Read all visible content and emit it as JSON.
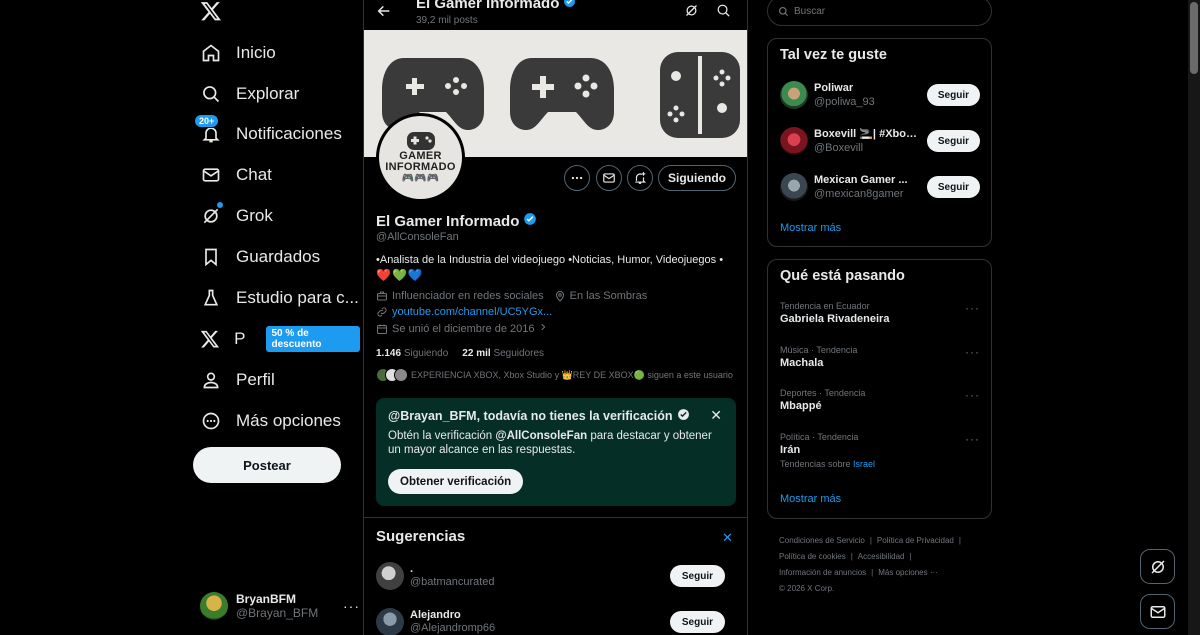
{
  "nav": {
    "items": [
      {
        "label": "Inicio",
        "icon": "home-icon"
      },
      {
        "label": "Explorar",
        "icon": "search-icon"
      },
      {
        "label": "Notificaciones",
        "icon": "bell-icon",
        "badge": "20+"
      },
      {
        "label": "Chat",
        "icon": "mail-icon"
      },
      {
        "label": "Grok",
        "icon": "grok-icon"
      },
      {
        "label": "Guardados",
        "icon": "bookmark-icon"
      },
      {
        "label": "Estudio para c...",
        "icon": "flask-icon"
      },
      {
        "label": "P",
        "icon": "x-logo-icon",
        "pill": "50 % de descuento"
      },
      {
        "label": "Perfil",
        "icon": "person-icon"
      },
      {
        "label": "Más opciones",
        "icon": "more-circle-icon"
      }
    ],
    "post_button": "Postear",
    "account": {
      "name": "BryanBFM",
      "handle": "@Brayan_BFM",
      "more": "···"
    }
  },
  "profile": {
    "top_title": "El Gamer Informado",
    "post_count": "39,2 mil posts",
    "avatar_text_1": "GAMER",
    "avatar_text_2": "INFORMADO",
    "following_button": "Siguiendo",
    "name": "El Gamer Informado",
    "handle": "@AllConsoleFan",
    "bio": "•Analista de la Industria del videojuego •Noticias, Humor, Videojuegos •",
    "hearts": [
      "❤️",
      "💚",
      "💙"
    ],
    "category": "Influenciador en redes sociales",
    "location": "En las Sombras",
    "link": "youtube.com/channel/UC5YGx...",
    "joined": "Se unió el diciembre de 2016",
    "following_count": "1.146",
    "following_label": "Siguiendo",
    "followers_count": "22 mil",
    "followers_label": "Seguidores",
    "known_followers": "EXPERIENCIA XBOX, Xbox Studio y 👑REY DE XBOX🟢 siguen a este usuario"
  },
  "verification": {
    "title": "@Brayan_BFM, todavía no tienes la verificación",
    "body_pre": "Obtén la verificación ",
    "body_handle": "@AllConsoleFan",
    "body_post": " para destacar y obtener un mayor alcance en las respuestas.",
    "button": "Obtener verificación",
    "close": "✕"
  },
  "suggestions": {
    "title": "Sugerencias",
    "close": "✕",
    "items": [
      {
        "name": ".",
        "handle": "@batmancurated",
        "button": "Seguir",
        "color": "#7a7a7a"
      },
      {
        "name": "Alejandro",
        "handle": "@Alejandromp66",
        "button": "Seguir",
        "color": "#4a5a6a"
      }
    ]
  },
  "search": {
    "placeholder": "Buscar"
  },
  "who_to_follow": {
    "title": "Tal vez te guste",
    "items": [
      {
        "name": "Poliwar",
        "handle": "@poliwa_93",
        "button": "Seguir",
        "color": "#3c8a4f"
      },
      {
        "name": "Boxevill 🚬| #Xbox...",
        "handle": "@Boxevill",
        "button": "Seguir",
        "color": "#a3202a"
      },
      {
        "name": "Mexican Gamer ...",
        "handle": "@mexican8gamer",
        "button": "Seguir",
        "color": "#5b6670"
      }
    ],
    "more": "Mostrar más"
  },
  "trends": {
    "title": "Qué está pasando",
    "items": [
      {
        "meta": "Tendencia en Ecuador",
        "name": "Gabriela Rivadeneira",
        "extra_pre": "",
        "extra_link": ""
      },
      {
        "meta": "Música · Tendencia",
        "name": "Machala",
        "extra_pre": "",
        "extra_link": ""
      },
      {
        "meta": "Deportes · Tendencia",
        "name": "Mbappé",
        "extra_pre": "",
        "extra_link": ""
      },
      {
        "meta": "Política · Tendencia",
        "name": "Irán",
        "extra_pre": "Tendencias sobre ",
        "extra_link": "Israel"
      }
    ],
    "more": "Mostrar más",
    "dots": "···"
  },
  "footer": {
    "links": [
      "Condiciones de Servicio",
      "Política de Privacidad",
      "Política de cookies",
      "Accesibilidad",
      "Información de anuncios",
      "Más opciones ···",
      "© 2026 X Corp."
    ]
  },
  "colors": {
    "accent": "#1d9bf0",
    "verify_bg": "#052e26",
    "border": "#2f3336",
    "muted": "#71767b"
  }
}
